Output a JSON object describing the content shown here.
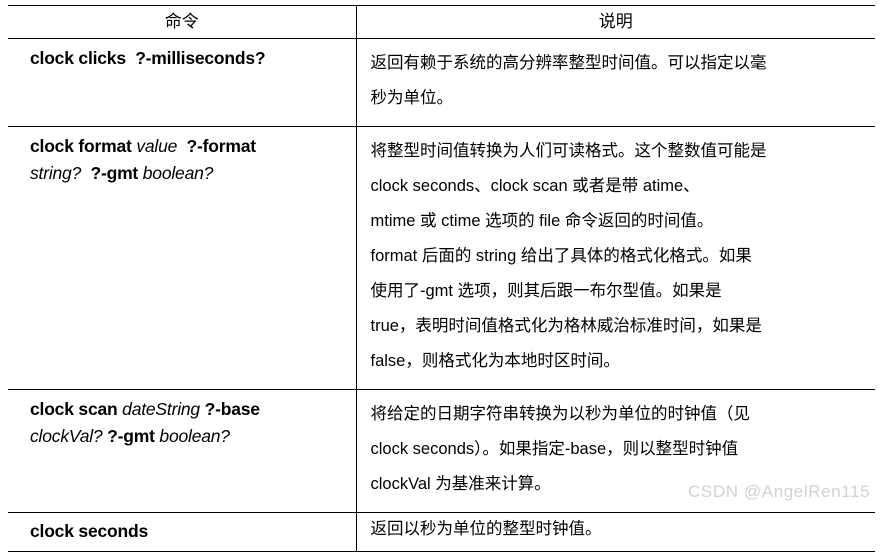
{
  "table": {
    "headers": {
      "command": "命令",
      "description": "说明"
    },
    "rows": [
      {
        "key": "clock-clicks",
        "command_plain": "clock clicks  ?-milliseconds?",
        "command_bold": "clock clicks  ?-milliseconds?",
        "description_lines": [
          "返回有赖于系统的高分辨率整型时间值。可以指定以毫",
          "秒为单位。"
        ]
      },
      {
        "key": "clock-format",
        "command_plain": "clock format value  ?-format string?  ?-gmt boolean?",
        "command_segments": [
          {
            "text": "clock format ",
            "style": "bold"
          },
          {
            "text": "value",
            "style": "italic"
          },
          {
            "text": "  ",
            "style": "plain"
          },
          {
            "text": "?-format",
            "style": "bold"
          },
          {
            "text": "\n",
            "style": "break"
          },
          {
            "text": "string?",
            "style": "italic"
          },
          {
            "text": "  ",
            "style": "plain"
          },
          {
            "text": "?-gmt",
            "style": "bold"
          },
          {
            "text": " ",
            "style": "plain"
          },
          {
            "text": "boolean?",
            "style": "italic"
          }
        ],
        "description_lines": [
          "将整型时间值转换为人们可读格式。这个整数值可能是",
          "clock seconds、clock scan 或者是带 atime、",
          "mtime 或 ctime 选项的 file 命令返回的时间值。",
          "format 后面的 string 给出了具体的格式化格式。如果",
          "使用了-gmt 选项，则其后跟一布尔型值。如果是",
          "true，表明时间值格式化为格林威治标准时间，如果是",
          "false，则格式化为本地时区时间。"
        ]
      },
      {
        "key": "clock-scan",
        "command_plain": "clock scan dateString ?-base clockVal? ?-gmt boolean?",
        "command_segments": [
          {
            "text": "clock scan ",
            "style": "bold"
          },
          {
            "text": "dateString",
            "style": "italic"
          },
          {
            "text": " ",
            "style": "plain"
          },
          {
            "text": "?-base",
            "style": "bold"
          },
          {
            "text": "\n",
            "style": "break"
          },
          {
            "text": "clockVal?",
            "style": "italic"
          },
          {
            "text": " ",
            "style": "plain"
          },
          {
            "text": "?-gmt",
            "style": "bold"
          },
          {
            "text": " ",
            "style": "plain"
          },
          {
            "text": "boolean?",
            "style": "italic"
          }
        ],
        "description_lines": [
          "将给定的日期字符串转换为以秒为单位的时钟值（见",
          "clock seconds）。如果指定-base，则以整型时钟值",
          "clockVal 为基准来计算。"
        ]
      },
      {
        "key": "clock-seconds",
        "command_plain": "clock seconds",
        "command_segments": [
          {
            "text": "clock seconds",
            "style": "bold"
          }
        ],
        "description_lines": [
          "返回以秒为单位的整型时钟值。"
        ]
      }
    ]
  },
  "watermark": {
    "text": "CSDN @AngelRen115",
    "color": "#d2d2d2"
  }
}
